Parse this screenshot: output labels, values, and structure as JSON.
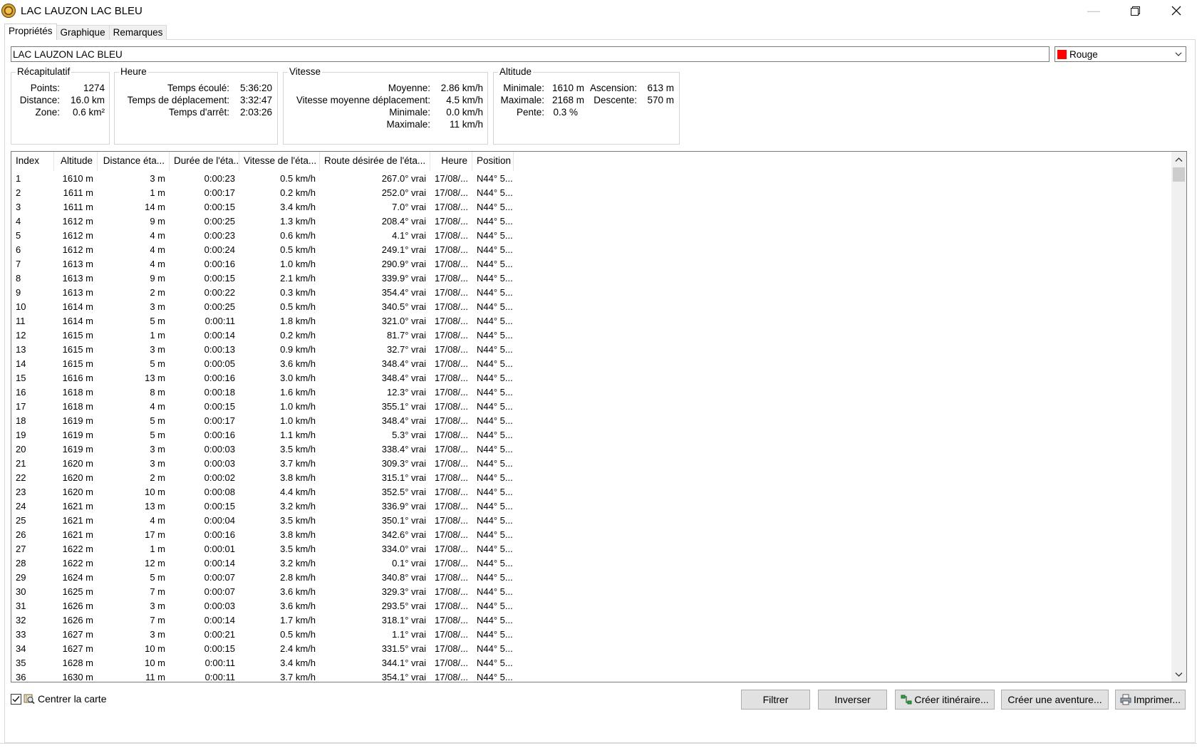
{
  "window": {
    "title": "LAC LAUZON LAC BLEU",
    "minimize": "—",
    "restore": "❐",
    "close": "✕"
  },
  "tabs": [
    {
      "label": "Propriétés",
      "active": true
    },
    {
      "label": "Graphique",
      "active": false
    },
    {
      "label": "Remarques",
      "active": false
    }
  ],
  "name_field": {
    "value": "LAC LAUZON LAC BLEU"
  },
  "color_select": {
    "value": "Rouge",
    "swatch": "#ff0000"
  },
  "recap": {
    "legend": "Récapitulatif",
    "points_label": "Points:",
    "points_value": "1274",
    "distance_label": "Distance:",
    "distance_value": "16.0 km",
    "zone_label": "Zone:",
    "zone_value": "0.6 km²"
  },
  "heure": {
    "legend": "Heure",
    "elapsed_label": "Temps écoulé:",
    "elapsed_value": "5:36:20",
    "moving_label": "Temps de déplacement:",
    "moving_value": "3:32:47",
    "stop_label": "Temps d'arrêt:",
    "stop_value": "2:03:26"
  },
  "vitesse": {
    "legend": "Vitesse",
    "avg_label": "Moyenne:",
    "avg_value": "2.86 km/h",
    "moving_avg_label": "Vitesse moyenne déplacement:",
    "moving_avg_value": "4.5 km/h",
    "min_label": "Minimale:",
    "min_value": "0.0 km/h",
    "max_label": "Maximale:",
    "max_value": "11 km/h"
  },
  "altitude": {
    "legend": "Altitude",
    "min_label": "Minimale:",
    "min_value": "1610 m",
    "max_label": "Maximale:",
    "max_value": "2168 m",
    "slope_label": "Pente:",
    "slope_value": "0.3 %",
    "ascent_label": "Ascension:",
    "ascent_value": "613 m",
    "descent_label": "Descente:",
    "descent_value": "570 m"
  },
  "table": {
    "columns": [
      "Index",
      "Altitude",
      "Distance éta...",
      "Durée de l'éta...",
      "Vitesse de l'éta...",
      "Route désirée de l'éta...",
      "Heure",
      "Position"
    ],
    "rows": [
      [
        "1",
        "1610 m",
        "3 m",
        "0:00:23",
        "0.5 km/h",
        "267.0° vrai",
        "17/08/...",
        "N44° 5..."
      ],
      [
        "2",
        "1611 m",
        "1 m",
        "0:00:17",
        "0.2 km/h",
        "252.0° vrai",
        "17/08/...",
        "N44° 5..."
      ],
      [
        "3",
        "1611 m",
        "14 m",
        "0:00:15",
        "3.4 km/h",
        "7.0° vrai",
        "17/08/...",
        "N44° 5..."
      ],
      [
        "4",
        "1612 m",
        "9 m",
        "0:00:25",
        "1.3 km/h",
        "208.4° vrai",
        "17/08/...",
        "N44° 5..."
      ],
      [
        "5",
        "1612 m",
        "4 m",
        "0:00:23",
        "0.6 km/h",
        "4.1° vrai",
        "17/08/...",
        "N44° 5..."
      ],
      [
        "6",
        "1612 m",
        "4 m",
        "0:00:24",
        "0.5 km/h",
        "249.1° vrai",
        "17/08/...",
        "N44° 5..."
      ],
      [
        "7",
        "1613 m",
        "4 m",
        "0:00:16",
        "1.0 km/h",
        "290.9° vrai",
        "17/08/...",
        "N44° 5..."
      ],
      [
        "8",
        "1613 m",
        "9 m",
        "0:00:15",
        "2.1 km/h",
        "339.9° vrai",
        "17/08/...",
        "N44° 5..."
      ],
      [
        "9",
        "1613 m",
        "2 m",
        "0:00:22",
        "0.3 km/h",
        "354.4° vrai",
        "17/08/...",
        "N44° 5..."
      ],
      [
        "10",
        "1614 m",
        "3 m",
        "0:00:25",
        "0.5 km/h",
        "340.5° vrai",
        "17/08/...",
        "N44° 5..."
      ],
      [
        "11",
        "1614 m",
        "5 m",
        "0:00:11",
        "1.8 km/h",
        "321.0° vrai",
        "17/08/...",
        "N44° 5..."
      ],
      [
        "12",
        "1615 m",
        "1 m",
        "0:00:14",
        "0.2 km/h",
        "81.7° vrai",
        "17/08/...",
        "N44° 5..."
      ],
      [
        "13",
        "1615 m",
        "3 m",
        "0:00:13",
        "0.9 km/h",
        "32.7° vrai",
        "17/08/...",
        "N44° 5..."
      ],
      [
        "14",
        "1615 m",
        "5 m",
        "0:00:05",
        "3.6 km/h",
        "348.4° vrai",
        "17/08/...",
        "N44° 5..."
      ],
      [
        "15",
        "1616 m",
        "13 m",
        "0:00:16",
        "3.0 km/h",
        "348.4° vrai",
        "17/08/...",
        "N44° 5..."
      ],
      [
        "16",
        "1618 m",
        "8 m",
        "0:00:18",
        "1.6 km/h",
        "12.3° vrai",
        "17/08/...",
        "N44° 5..."
      ],
      [
        "17",
        "1618 m",
        "4 m",
        "0:00:15",
        "1.0 km/h",
        "355.1° vrai",
        "17/08/...",
        "N44° 5..."
      ],
      [
        "18",
        "1619 m",
        "5 m",
        "0:00:17",
        "1.0 km/h",
        "348.4° vrai",
        "17/08/...",
        "N44° 5..."
      ],
      [
        "19",
        "1619 m",
        "5 m",
        "0:00:16",
        "1.1 km/h",
        "5.3° vrai",
        "17/08/...",
        "N44° 5..."
      ],
      [
        "20",
        "1619 m",
        "3 m",
        "0:00:03",
        "3.5 km/h",
        "338.4° vrai",
        "17/08/...",
        "N44° 5..."
      ],
      [
        "21",
        "1620 m",
        "3 m",
        "0:00:03",
        "3.7 km/h",
        "309.3° vrai",
        "17/08/...",
        "N44° 5..."
      ],
      [
        "22",
        "1620 m",
        "2 m",
        "0:00:02",
        "3.8 km/h",
        "315.1° vrai",
        "17/08/...",
        "N44° 5..."
      ],
      [
        "23",
        "1620 m",
        "10 m",
        "0:00:08",
        "4.4 km/h",
        "352.5° vrai",
        "17/08/...",
        "N44° 5..."
      ],
      [
        "24",
        "1621 m",
        "13 m",
        "0:00:15",
        "3.2 km/h",
        "336.9° vrai",
        "17/08/...",
        "N44° 5..."
      ],
      [
        "25",
        "1621 m",
        "4 m",
        "0:00:04",
        "3.5 km/h",
        "350.1° vrai",
        "17/08/...",
        "N44° 5..."
      ],
      [
        "26",
        "1621 m",
        "17 m",
        "0:00:16",
        "3.8 km/h",
        "342.6° vrai",
        "17/08/...",
        "N44° 5..."
      ],
      [
        "27",
        "1622 m",
        "1 m",
        "0:00:01",
        "3.5 km/h",
        "334.0° vrai",
        "17/08/...",
        "N44° 5..."
      ],
      [
        "28",
        "1622 m",
        "12 m",
        "0:00:14",
        "3.2 km/h",
        "0.1° vrai",
        "17/08/...",
        "N44° 5..."
      ],
      [
        "29",
        "1624 m",
        "5 m",
        "0:00:07",
        "2.8 km/h",
        "340.8° vrai",
        "17/08/...",
        "N44° 5..."
      ],
      [
        "30",
        "1625 m",
        "7 m",
        "0:00:07",
        "3.6 km/h",
        "329.3° vrai",
        "17/08/...",
        "N44° 5..."
      ],
      [
        "31",
        "1626 m",
        "3 m",
        "0:00:03",
        "3.6 km/h",
        "293.5° vrai",
        "17/08/...",
        "N44° 5..."
      ],
      [
        "32",
        "1626 m",
        "7 m",
        "0:00:14",
        "1.7 km/h",
        "318.1° vrai",
        "17/08/...",
        "N44° 5..."
      ],
      [
        "33",
        "1627 m",
        "3 m",
        "0:00:21",
        "0.5 km/h",
        "1.1° vrai",
        "17/08/...",
        "N44° 5..."
      ],
      [
        "34",
        "1627 m",
        "10 m",
        "0:00:15",
        "2.4 km/h",
        "331.5° vrai",
        "17/08/...",
        "N44° 5..."
      ],
      [
        "35",
        "1628 m",
        "10 m",
        "0:00:11",
        "3.4 km/h",
        "344.1° vrai",
        "17/08/...",
        "N44° 5..."
      ],
      [
        "36",
        "1630 m",
        "11 m",
        "0:00:11",
        "3.7 km/h",
        "354.1° vrai",
        "17/08/...",
        "N44° 5..."
      ]
    ]
  },
  "bottom": {
    "center_map_label": "Centrer la carte",
    "center_map_checked": true,
    "filter_label": "Filtrer",
    "invert_label": "Inverser",
    "create_route_label": "Créer itinéraire...",
    "create_adventure_label": "Créer une aventure...",
    "print_label": "Imprimer..."
  }
}
